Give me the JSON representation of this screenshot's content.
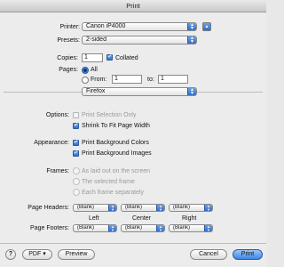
{
  "window": {
    "title": "Print"
  },
  "printer": {
    "label": "Printer:",
    "value": "Canon iP4000"
  },
  "presets": {
    "label": "Presets:",
    "value": "2-sided"
  },
  "copies": {
    "label": "Copies:",
    "value": "1",
    "collated_label": "Collated"
  },
  "pages": {
    "label": "Pages:",
    "all_label": "All",
    "from_label": "From:",
    "from_value": "1",
    "to_label": "to:",
    "to_value": "1"
  },
  "section": {
    "value": "Firefox"
  },
  "options": {
    "label": "Options:",
    "print_selection_only": "Print Selection Only",
    "shrink_to_fit": "Shrink To Fit Page Width"
  },
  "appearance": {
    "label": "Appearance:",
    "bg_colors": "Print Background Colors",
    "bg_images": "Print Background Images"
  },
  "frames": {
    "label": "Frames:",
    "as_laid_out": "As laid out on the screen",
    "selected_frame": "The selected frame",
    "each_frame": "Each frame separately"
  },
  "headers": {
    "label": "Page Headers:",
    "left": "(Blank)",
    "center": "(Blank)",
    "right": "(Blank)"
  },
  "columns": {
    "left": "Left",
    "center": "Center",
    "right": "Right"
  },
  "footers": {
    "label": "Page Footers:",
    "left": "(Blank)",
    "center": "(Blank)",
    "right": "(Blank)"
  },
  "bottom": {
    "help": "?",
    "pdf": "PDF ▾",
    "preview": "Preview",
    "cancel": "Cancel",
    "print": "Print"
  }
}
